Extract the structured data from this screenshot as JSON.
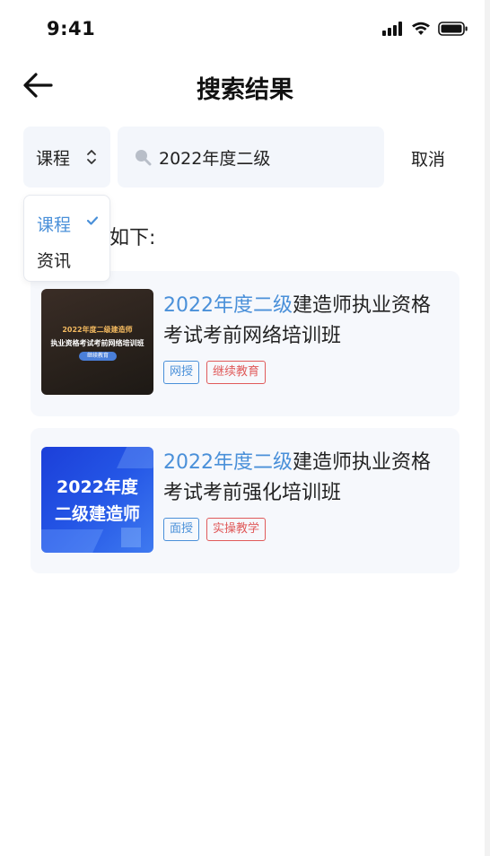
{
  "status_bar": {
    "time": "9:41",
    "icons": [
      "signal-icon",
      "wifi-icon",
      "battery-icon"
    ]
  },
  "nav": {
    "title": "搜索结果",
    "back_icon": "arrow-left-icon"
  },
  "search": {
    "category_selected": "课程",
    "query": "2022年度二级",
    "cancel_label": "取消"
  },
  "dropdown": {
    "options": [
      "课程",
      "资讯"
    ],
    "selected_index": 0
  },
  "result_hint": "如下:",
  "results": [
    {
      "title_highlight": "2022年度二级",
      "title_rest": "建造师执业资格考试考前网络培训班",
      "thumb_line1": "2022年度二级建造师",
      "thumb_line2": "执业资格考试考前网络培训班",
      "thumb_pill": "继续教育",
      "tags": [
        {
          "label": "网授",
          "color": "blue"
        },
        {
          "label": "继续教育",
          "color": "red"
        }
      ]
    },
    {
      "title_highlight": "2022年度二级",
      "title_rest": "建造师执业资格考试考前强化培训班",
      "thumb_line1": "2022年度",
      "thumb_line2": "二级建造师",
      "tags": [
        {
          "label": "面授",
          "color": "blue"
        },
        {
          "label": "实操教学",
          "color": "red"
        }
      ]
    }
  ],
  "colors": {
    "accent": "#4a90d9",
    "tag_red": "#e05a5a",
    "input_bg": "#f3f6fb",
    "card_bg": "#f6f8fc"
  }
}
